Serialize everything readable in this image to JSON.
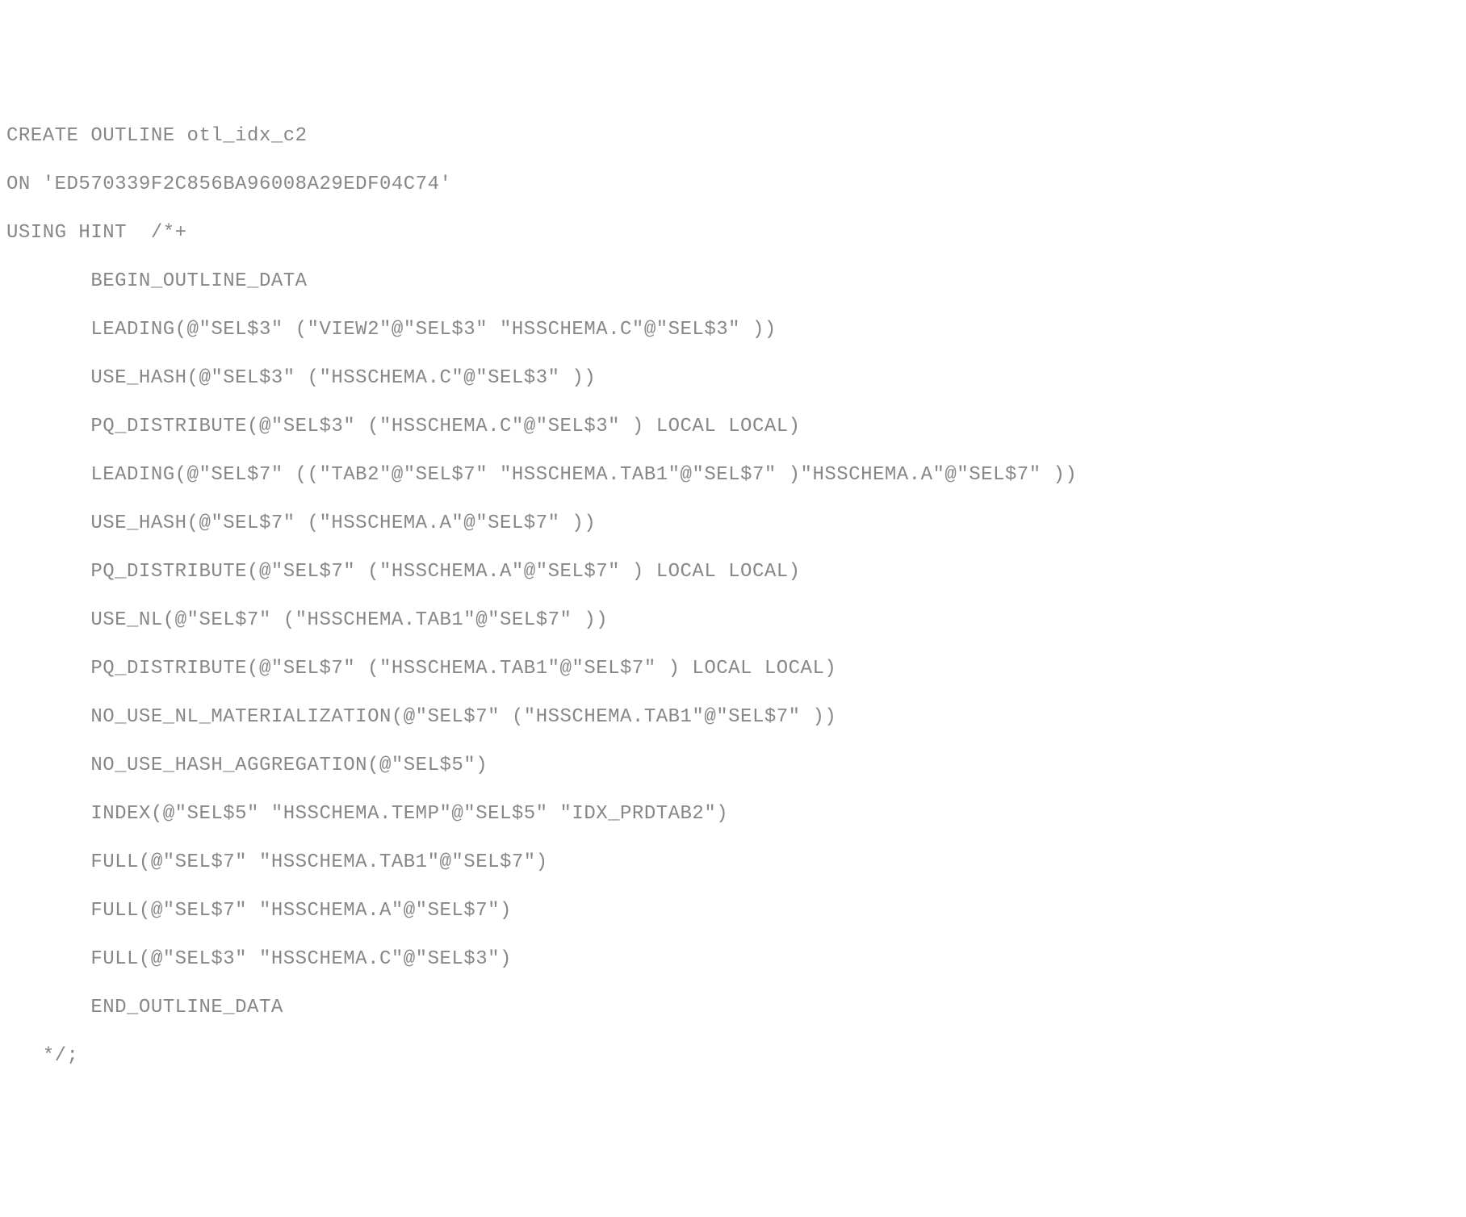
{
  "code": {
    "line1": "CREATE OUTLINE otl_idx_c2",
    "line2": "ON 'ED570339F2C856BA96008A29EDF04C74'",
    "line3": "USING HINT  /*+",
    "line4": "       BEGIN_OUTLINE_DATA",
    "line5": "       LEADING(@\"SEL$3\" (\"VIEW2\"@\"SEL$3\" \"HSSCHEMA.C\"@\"SEL$3\" ))",
    "line6": "       USE_HASH(@\"SEL$3\" (\"HSSCHEMA.C\"@\"SEL$3\" ))",
    "line7": "       PQ_DISTRIBUTE(@\"SEL$3\" (\"HSSCHEMA.C\"@\"SEL$3\" ) LOCAL LOCAL)",
    "line8": "       LEADING(@\"SEL$7\" ((\"TAB2\"@\"SEL$7\" \"HSSCHEMA.TAB1\"@\"SEL$7\" )\"HSSCHEMA.A\"@\"SEL$7\" ))",
    "line9": "       USE_HASH(@\"SEL$7\" (\"HSSCHEMA.A\"@\"SEL$7\" ))",
    "line10": "       PQ_DISTRIBUTE(@\"SEL$7\" (\"HSSCHEMA.A\"@\"SEL$7\" ) LOCAL LOCAL)",
    "line11": "       USE_NL(@\"SEL$7\" (\"HSSCHEMA.TAB1\"@\"SEL$7\" ))",
    "line12": "       PQ_DISTRIBUTE(@\"SEL$7\" (\"HSSCHEMA.TAB1\"@\"SEL$7\" ) LOCAL LOCAL)",
    "line13": "       NO_USE_NL_MATERIALIZATION(@\"SEL$7\" (\"HSSCHEMA.TAB1\"@\"SEL$7\" ))",
    "line14": "       NO_USE_HASH_AGGREGATION(@\"SEL$5\")",
    "line15": "       INDEX(@\"SEL$5\" \"HSSCHEMA.TEMP\"@\"SEL$5\" \"IDX_PRDTAB2\")",
    "line16": "       FULL(@\"SEL$7\" \"HSSCHEMA.TAB1\"@\"SEL$7\")",
    "line17": "       FULL(@\"SEL$7\" \"HSSCHEMA.A\"@\"SEL$7\")",
    "line18": "       FULL(@\"SEL$3\" \"HSSCHEMA.C\"@\"SEL$3\")",
    "line19": "       END_OUTLINE_DATA",
    "line20": "   */;"
  }
}
